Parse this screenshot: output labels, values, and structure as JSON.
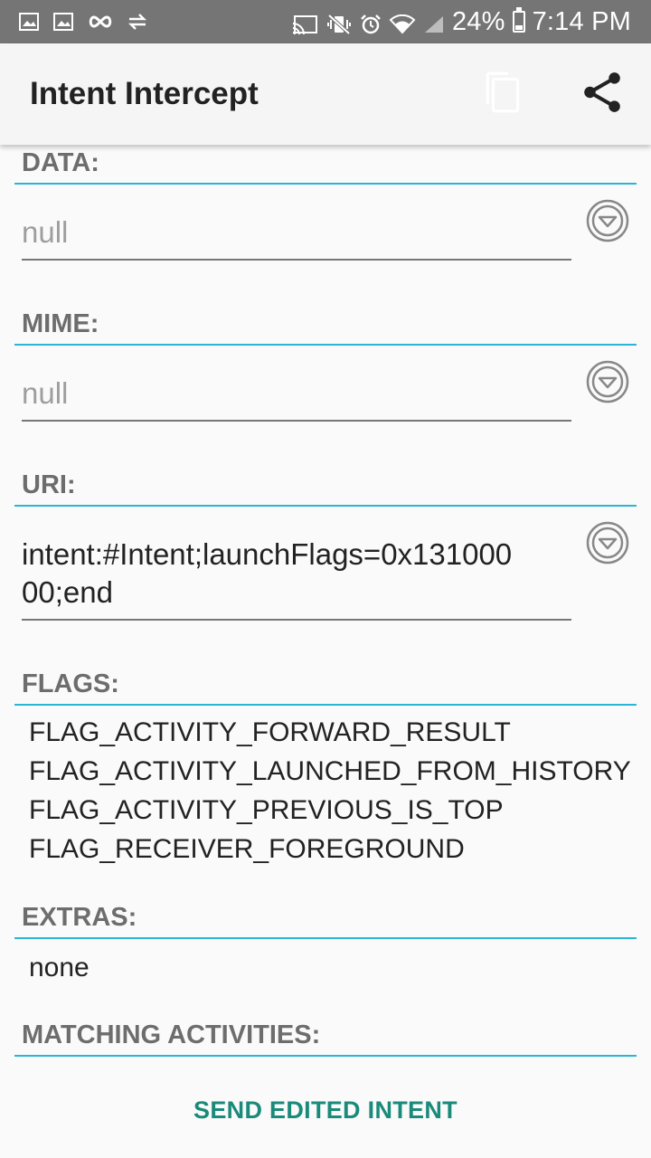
{
  "status_bar": {
    "battery": "24%",
    "time": "7:14 PM",
    "icons": [
      "gallery-icon",
      "gallery-icon",
      "infinity-icon",
      "swap-icon",
      "cast-icon",
      "vibrate-mute-icon",
      "alarm-icon",
      "wifi-icon",
      "signal-icon",
      "battery-icon"
    ]
  },
  "toolbar": {
    "title": "Intent Intercept",
    "copy_icon": "copy-icon",
    "share_icon": "share-icon"
  },
  "sections": {
    "data": {
      "label": "DATA:",
      "value": "null"
    },
    "mime": {
      "label": "MIME:",
      "value": "null"
    },
    "uri": {
      "label": "URI:",
      "value_line1": "intent:#Intent;launchFlags=0x131000",
      "value_line2": "00;end"
    },
    "flags": {
      "label": "FLAGS:",
      "items": [
        "FLAG_ACTIVITY_FORWARD_RESULT",
        "FLAG_ACTIVITY_LAUNCHED_FROM_HISTORY",
        "FLAG_ACTIVITY_PREVIOUS_IS_TOP",
        "FLAG_RECEIVER_FOREGROUND"
      ]
    },
    "extras": {
      "label": "EXTRAS:",
      "value": "none"
    },
    "matching": {
      "label": "MATCHING ACTIVITIES:"
    }
  },
  "send_button": "SEND EDITED INTENT",
  "colors": {
    "accent_line": "#29b6d6",
    "button_text": "#1a8a7a",
    "status_bar": "#757575"
  }
}
